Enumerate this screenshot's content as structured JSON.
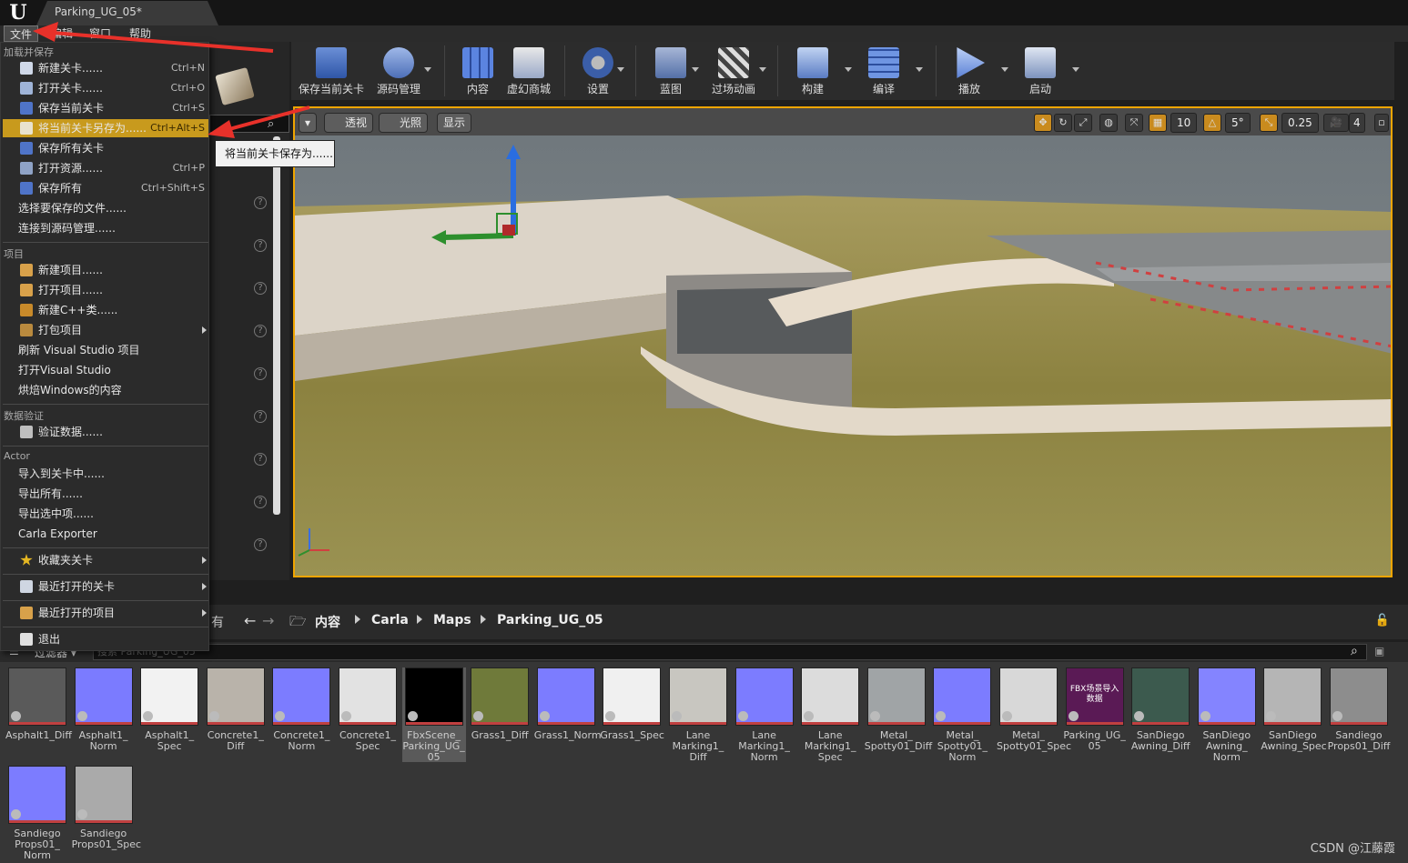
{
  "window": {
    "doc_tab": "Parking_UG_05*",
    "logo": "U"
  },
  "menubar": {
    "file": "文件",
    "edit": "编辑",
    "window": "窗口",
    "help": "帮助"
  },
  "toolbar": {
    "save": "保存当前关卡",
    "source": "源码管理",
    "content": "内容",
    "market": "虚幻商城",
    "settings": "设置",
    "blueprint": "蓝图",
    "cinematics": "过场动画",
    "build": "构建",
    "compile": "编译",
    "play": "播放",
    "launch": "启动"
  },
  "viewport": {
    "perspective": "透视",
    "lit": "光照",
    "show": "显示",
    "grid_snap": "10",
    "rot_snap": "5°",
    "scale_snap": "0.25",
    "cam_speed": "4"
  },
  "file_menu": {
    "sections": {
      "load_save": "加载并保存",
      "project": "项目",
      "validation": "数据验证",
      "actor": "Actor"
    },
    "new_level": {
      "label": "新建关卡......",
      "shortcut": "Ctrl+N"
    },
    "open_level": {
      "label": "打开关卡......",
      "shortcut": "Ctrl+O"
    },
    "save_level": {
      "label": "保存当前关卡",
      "shortcut": "Ctrl+S"
    },
    "save_as": {
      "label": "将当前关卡另存为......",
      "shortcut": "Ctrl+Alt+S"
    },
    "save_all_levels": {
      "label": "保存所有关卡"
    },
    "open_asset": {
      "label": "打开资源......",
      "shortcut": "Ctrl+P"
    },
    "save_all": {
      "label": "保存所有",
      "shortcut": "Ctrl+Shift+S"
    },
    "choose_files": "选择要保存的文件......",
    "connect_source": "连接到源码管理......",
    "new_project": "新建项目......",
    "open_project": "打开项目......",
    "new_cpp": "新建C++类......",
    "package": "打包项目",
    "refresh_vs": "刷新 Visual Studio 项目",
    "open_vs": "打开Visual Studio",
    "cook_windows": "烘焙Windows的内容",
    "validate": "验证数据......",
    "import_level": "导入到关卡中......",
    "export_all": "导出所有......",
    "export_selected": "导出选中项......",
    "carla_exporter": "Carla Exporter",
    "favorites": "收藏夹关卡",
    "recent_levels": "最近打开的关卡",
    "recent_projects": "最近打开的项目",
    "exit": "退出"
  },
  "tooltip": "将当前关卡保存为......",
  "content_browser": {
    "left_label": "有",
    "breadcrumb": [
      "内容",
      "Carla",
      "Maps",
      "Parking_UG_05"
    ],
    "filter": "过滤器",
    "search_placeholder": "搜索 Parking_UG_05",
    "fbx_thumb_text": "FBX场景导入数据"
  },
  "assets": [
    {
      "name": "Asphalt1_Diff",
      "color": "#5a5a5a"
    },
    {
      "name": "Asphalt1_ Norm",
      "color": "#7b7bff"
    },
    {
      "name": "Asphalt1_ Spec",
      "color": "#f2f2f2"
    },
    {
      "name": "Concrete1_ Diff",
      "color": "#b9b3aa"
    },
    {
      "name": "Concrete1_ Norm",
      "color": "#7c7cff"
    },
    {
      "name": "Concrete1_ Spec",
      "color": "#e2e2e2"
    },
    {
      "name": "FbxScene_ Parking_UG_ 05",
      "color": "#000000"
    },
    {
      "name": "Grass1_Diff",
      "color": "#6f7a3a"
    },
    {
      "name": "Grass1_Norm",
      "color": "#7c7cff"
    },
    {
      "name": "Grass1_Spec",
      "color": "#f0f0f0"
    },
    {
      "name": "Lane Marking1_ Diff",
      "color": "#c8c6c0"
    },
    {
      "name": "Lane Marking1_ Norm",
      "color": "#7c7cff"
    },
    {
      "name": "Lane Marking1_ Spec",
      "color": "#dcdcdc"
    },
    {
      "name": "Metal_ Spotty01_Diff",
      "color": "#a0a4a6"
    },
    {
      "name": "Metal_ Spotty01_ Norm",
      "color": "#7c7cff"
    },
    {
      "name": "Metal_ Spotty01_Spec",
      "color": "#d8d8d8"
    },
    {
      "name": "Parking_UG_ 05",
      "color": "#5a1a55"
    },
    {
      "name": "SanDiego Awning_Diff",
      "color": "#3c5a4e"
    },
    {
      "name": "SanDiego Awning_ Norm",
      "color": "#8484ff"
    },
    {
      "name": "SanDiego Awning_Spec",
      "color": "#b5b5b5"
    },
    {
      "name": "Sandiego Props01_Diff",
      "color": "#8d8d8d"
    },
    {
      "name": "Sandiego Props01_ Norm",
      "color": "#7c7cff"
    },
    {
      "name": "Sandiego Props01_Spec",
      "color": "#aaaaaa"
    }
  ],
  "watermark": "CSDN @江藤霞"
}
